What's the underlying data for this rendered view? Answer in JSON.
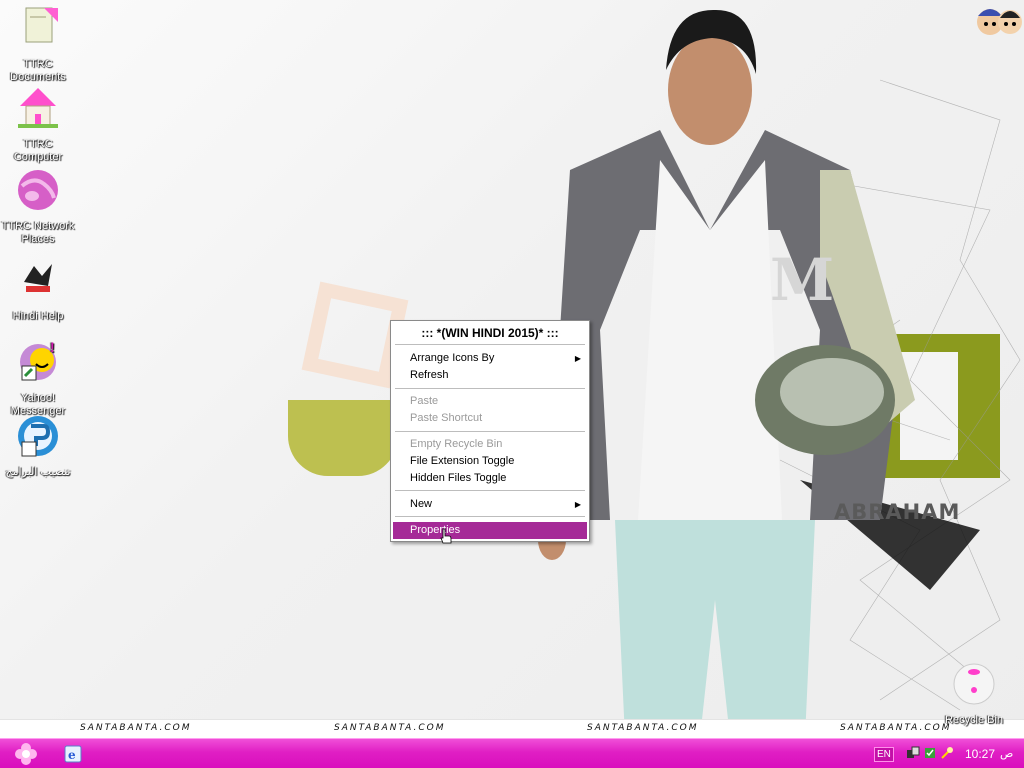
{
  "desktop": {
    "icons": [
      {
        "label": "TTRC Documents"
      },
      {
        "label": "TTRC Computer"
      },
      {
        "label": "TTRC Network Places"
      },
      {
        "label": "Hindi Help"
      },
      {
        "label": "Yahoo! Messenger"
      },
      {
        "label": "تنصيب البرامج"
      },
      {
        "label": "Recycle Bin"
      }
    ]
  },
  "wallpaper": {
    "name_text": "ABRAHAM",
    "watermark": "SANTABANTA.COM"
  },
  "context_menu": {
    "title": "::: *(WIN HINDI 2015)* :::",
    "items": [
      {
        "label": "Arrange Icons By",
        "submenu": true
      },
      {
        "label": "Refresh"
      },
      {
        "label": "Paste",
        "disabled": true
      },
      {
        "label": "Paste Shortcut",
        "disabled": true
      },
      {
        "label": "Empty Recycle Bin",
        "disabled": true
      },
      {
        "label": "File Extension Toggle"
      },
      {
        "label": "Hidden Files Toggle"
      },
      {
        "label": "New",
        "submenu": true
      },
      {
        "label": "Properties",
        "selected": true
      }
    ]
  },
  "taskbar": {
    "language": "EN",
    "clock": "10:27",
    "ampm": "ص"
  },
  "colors": {
    "taskbar": "#e01fc4",
    "menu_highlight": "#a52a97"
  }
}
